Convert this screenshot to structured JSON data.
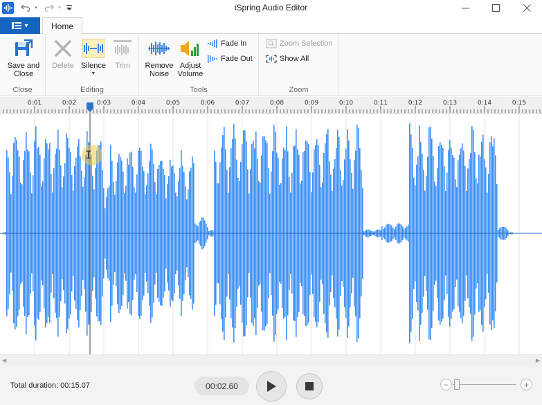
{
  "window": {
    "title": "iSpring Audio Editor",
    "minimize_icon": "minimize-icon",
    "maximize_icon": "maximize-icon",
    "close_icon": "close-icon"
  },
  "quick_access": {
    "undo": "undo-icon",
    "redo": "redo-icon",
    "customize": "customize-icon"
  },
  "tabs": {
    "file": "file-menu",
    "home": "Home"
  },
  "ribbon": {
    "groups": {
      "close": "Close",
      "editing": "Editing",
      "tools": "Tools",
      "zoom": "Zoom"
    },
    "save_and_close": {
      "line1": "Save and",
      "line2": "Close"
    },
    "delete": "Delete",
    "silence": "Silence",
    "trim": "Trim",
    "remove_noise": {
      "line1": "Remove",
      "line2": "Noise"
    },
    "adjust_volume": {
      "line1": "Adjust",
      "line2": "Volume"
    },
    "fade_in": "Fade In",
    "fade_out": "Fade Out",
    "zoom_selection": "Zoom Selection",
    "show_all": "Show All"
  },
  "timeline": {
    "ticks": [
      "0:01",
      "0:02",
      "0:03",
      "0:04",
      "0:05",
      "0:06",
      "0:07",
      "0:08",
      "0:09",
      "0:10",
      "0:11",
      "0:12",
      "0:13",
      "0:14",
      "0:15"
    ],
    "playhead_seconds": 2.6,
    "total_seconds": 15.07
  },
  "status": {
    "total_duration": "Total duration: 00:15.07",
    "current_time": "00:02.60"
  },
  "colors": {
    "waveform": "#3d8ff5",
    "accent": "#1565c0"
  }
}
